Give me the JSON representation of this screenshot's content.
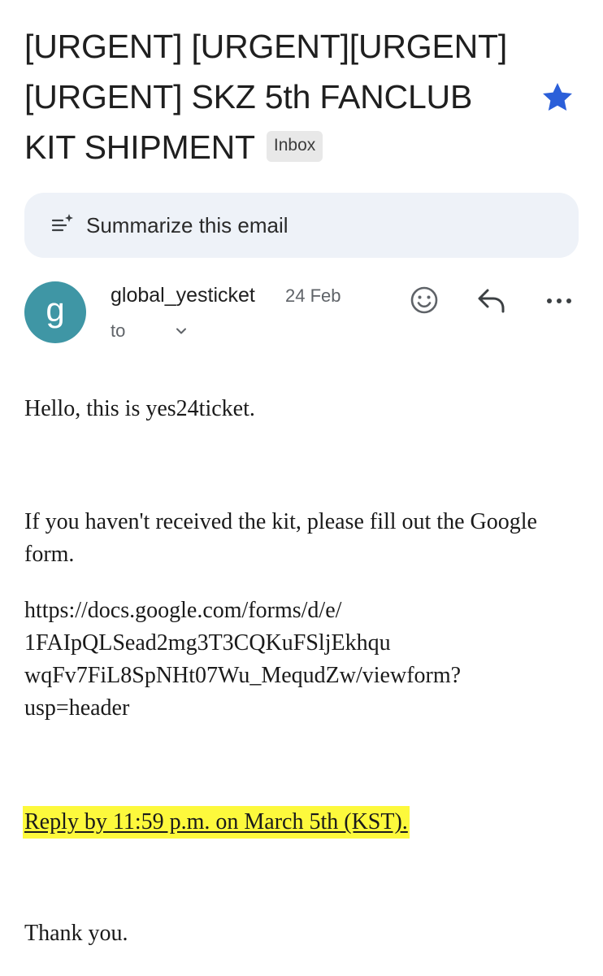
{
  "email": {
    "subject_lines": [
      "[URGENT] [URGENT][URGENT]",
      "[URGENT]  SKZ 5th FANCLUB",
      "KIT SHIPMENT"
    ],
    "label": "Inbox",
    "starred": true,
    "summarize_label": "Summarize this email",
    "sender": {
      "avatar_letter": "g",
      "name": "global_yesticket",
      "date": "24 Feb",
      "to_label": "to"
    },
    "body": {
      "greeting": "Hello, this is yes24ticket.",
      "paragraph": "If you haven't received the kit, please fill out the Google form.",
      "link_lines": [
        "https://docs.google.com/forms/d/e/",
        "1FAIpQLSead2mg3T3CQKuFSljEkhqu",
        "wqFv7FiL8SpNHt07Wu_MequdZw/viewform?",
        "usp=header"
      ],
      "deadline": "Reply by 11:59 p.m. on March 5th (KST).",
      "closing": "Thank you."
    }
  },
  "colors": {
    "star": "#2b5fd9",
    "avatar": "#3f96a5",
    "highlight": "#fdf93c",
    "summarize_bg": "#eef2f8"
  },
  "icons": [
    "star-icon",
    "summarize-sparkle-icon",
    "chevron-down-icon",
    "emoji-icon",
    "reply-icon",
    "more-icon"
  ]
}
